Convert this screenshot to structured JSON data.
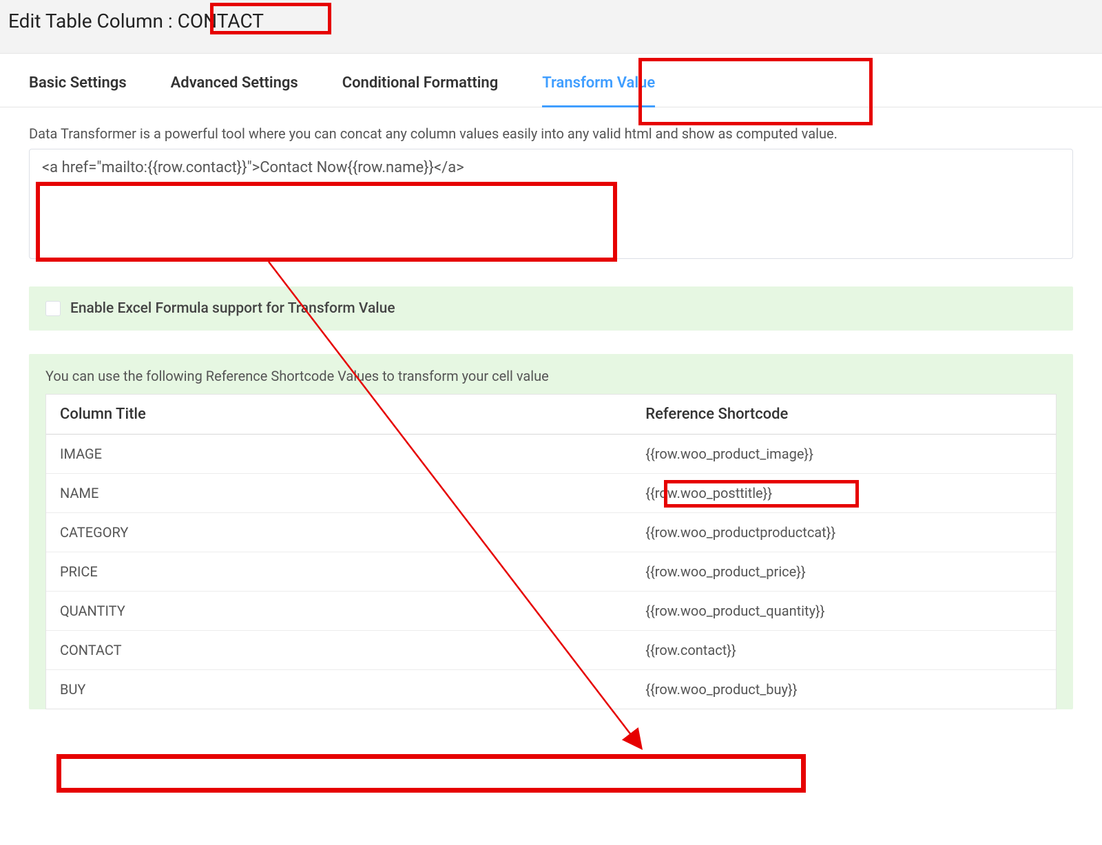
{
  "header": {
    "prefix": "Edit Table Column : ",
    "name": "CONTACT"
  },
  "tabs": {
    "basic": "Basic Settings",
    "advanced": "Advanced Settings",
    "conditional": "Conditional Formatting",
    "transform": "Transform Value"
  },
  "transform": {
    "description": "Data Transformer is a powerful tool where you can concat any column values easily into any valid html and show as computed value.",
    "value_pre": "<a href=\"mailto:",
    "value_u1": "{{row.contact}}",
    "value_mid": "\">Contact Now",
    "value_u2": "{{row.name}}",
    "value_post": "</a>"
  },
  "excel": {
    "label": "Enable Excel Formula support for Transform Value"
  },
  "reference": {
    "description": "You can use the following Reference Shortcode Values to transform your cell value",
    "head_col1": "Column Title",
    "head_col2": "Reference Shortcode",
    "rows": [
      {
        "title": "IMAGE",
        "code": "{{row.woo_product_image}}"
      },
      {
        "title": "NAME",
        "code": "{{row.woo_posttitle}}"
      },
      {
        "title": "CATEGORY",
        "code": "{{row.woo_productproductcat}}"
      },
      {
        "title": "PRICE",
        "code": "{{row.woo_product_price}}"
      },
      {
        "title": "QUANTITY",
        "code": "{{row.woo_product_quantity}}"
      },
      {
        "title": "CONTACT",
        "code": "{{row.contact}}"
      },
      {
        "title": "BUY",
        "code": "{{row.woo_product_buy}}"
      }
    ]
  }
}
